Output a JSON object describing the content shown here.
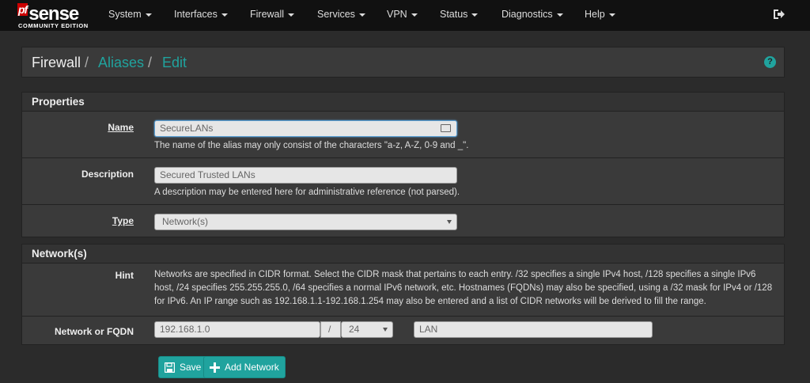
{
  "nav": {
    "logo_pf": "pf",
    "logo_sense": "sense",
    "logo_edition": "COMMUNITY EDITION",
    "menus": [
      "System",
      "Interfaces",
      "Firewall",
      "Services",
      "VPN",
      "Status",
      "Diagnostics",
      "Help"
    ]
  },
  "breadcrumb": {
    "first": "Firewall",
    "second": "Aliases",
    "third": "Edit",
    "separator": "/",
    "help_glyph": "?"
  },
  "properties": {
    "title": "Properties",
    "name_label": "Name",
    "name_value": "SecureLANs",
    "name_help": "The name of the alias may only consist of the characters \"a-z, A-Z, 0-9 and _\".",
    "description_label": "Description",
    "description_value": "Secured Trusted LANs",
    "description_help": "A description may be entered here for administrative reference (not parsed).",
    "type_label": "Type",
    "type_value": "Network(s)"
  },
  "networks": {
    "title": "Network(s)",
    "hint_label": "Hint",
    "hint_text": "Networks are specified in CIDR format. Select the CIDR mask that pertains to each entry. /32 specifies a single IPv4 host, /128 specifies a single IPv6 host, /24 specifies 255.255.255.0, /64 specifies a normal IPv6 network, etc. Hostnames (FQDNs) may also be specified, using a /32 mask for IPv4 or /128 for IPv6. An IP range such as 192.168.1.1-192.168.1.254 may also be entered and a list of CIDR networks will be derived to fill the range.",
    "entry_label": "Network or FQDN",
    "address": "192.168.1.0",
    "slash": "/",
    "mask": "24",
    "entry_description": "LAN"
  },
  "buttons": {
    "save": "Save",
    "add_network": "Add Network"
  },
  "colors": {
    "accent": "#20a39e",
    "navbar": "#111111",
    "panel": "#3a3a3a"
  }
}
